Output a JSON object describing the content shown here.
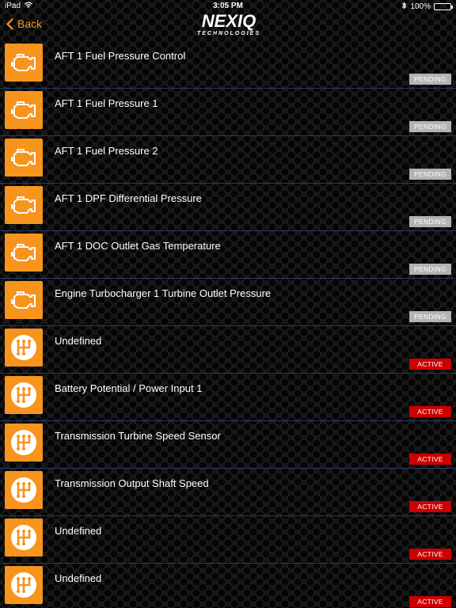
{
  "status_bar": {
    "carrier": "iPad",
    "time": "3:05 PM",
    "battery": "100%"
  },
  "nav": {
    "back_label": "Back",
    "logo_brand": "NEXIQ",
    "logo_sub": "TECHNOLOGIES"
  },
  "colors": {
    "accent": "#f7941d",
    "pending": "#b3b3b3",
    "active": "#cc0000"
  },
  "rows": [
    {
      "icon": "engine-icon",
      "label": "AFT 1 Fuel Pressure Control",
      "status": "PENDING"
    },
    {
      "icon": "engine-icon",
      "label": "AFT 1 Fuel Pressure 1",
      "status": "PENDING"
    },
    {
      "icon": "engine-icon",
      "label": "AFT 1 Fuel Pressure 2",
      "status": "PENDING"
    },
    {
      "icon": "engine-icon",
      "label": "AFT 1 DPF Differential Pressure",
      "status": "PENDING"
    },
    {
      "icon": "engine-icon",
      "label": "AFT 1 DOC Outlet Gas Temperature",
      "status": "PENDING"
    },
    {
      "icon": "engine-icon",
      "label": "Engine Turbocharger 1 Turbine Outlet Pressure",
      "status": "PENDING"
    },
    {
      "icon": "transmission-icon",
      "label": "Undefined",
      "status": "ACTIVE"
    },
    {
      "icon": "transmission-icon",
      "label": "Battery Potential / Power Input 1",
      "status": "ACTIVE"
    },
    {
      "icon": "transmission-icon",
      "label": "Transmission Turbine Speed Sensor",
      "status": "ACTIVE"
    },
    {
      "icon": "transmission-icon",
      "label": "Transmission Output Shaft Speed",
      "status": "ACTIVE"
    },
    {
      "icon": "transmission-icon",
      "label": "Undefined",
      "status": "ACTIVE"
    },
    {
      "icon": "transmission-icon",
      "label": "Undefined",
      "status": "ACTIVE"
    }
  ]
}
